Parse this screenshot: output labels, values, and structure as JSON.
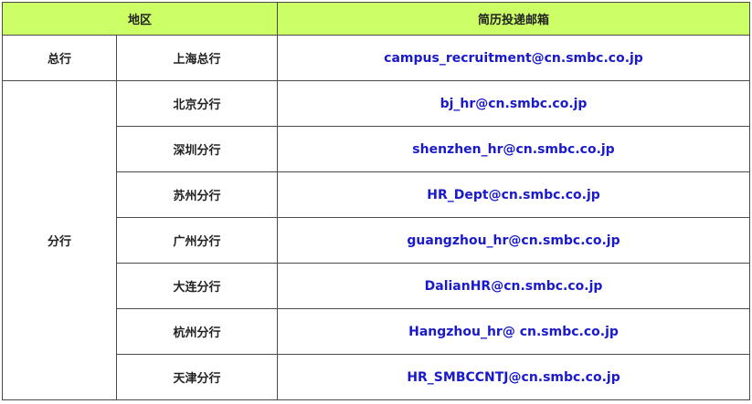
{
  "header": {
    "region": "地区",
    "email": "简历投递邮箱"
  },
  "headquarters": {
    "category": "总行",
    "branch": "上海总行",
    "email": "campus_recruitment@cn.smbc.co.jp"
  },
  "branches": {
    "category": "分行",
    "rows": [
      {
        "branch": "北京分行",
        "email": "bj_hr@cn.smbc.co.jp"
      },
      {
        "branch": "深圳分行",
        "email": "shenzhen_hr@cn.smbc.co.jp"
      },
      {
        "branch": "苏州分行",
        "email": "HR_Dept@cn.smbc.co.jp"
      },
      {
        "branch": "广州分行",
        "email": "guangzhou_hr@cn.smbc.co.jp"
      },
      {
        "branch": "大连分行",
        "email": "DalianHR@cn.smbc.co.jp"
      },
      {
        "branch": "杭州分行",
        "email": "Hangzhou_hr@ cn.smbc.co.jp"
      },
      {
        "branch": "天津分行",
        "email": "HR_SMBCCNTJ@cn.smbc.co.jp"
      }
    ]
  },
  "colors": {
    "header_bg": "#ccff66",
    "email_text": "#1a1acc",
    "border": "#4a4a4a"
  }
}
